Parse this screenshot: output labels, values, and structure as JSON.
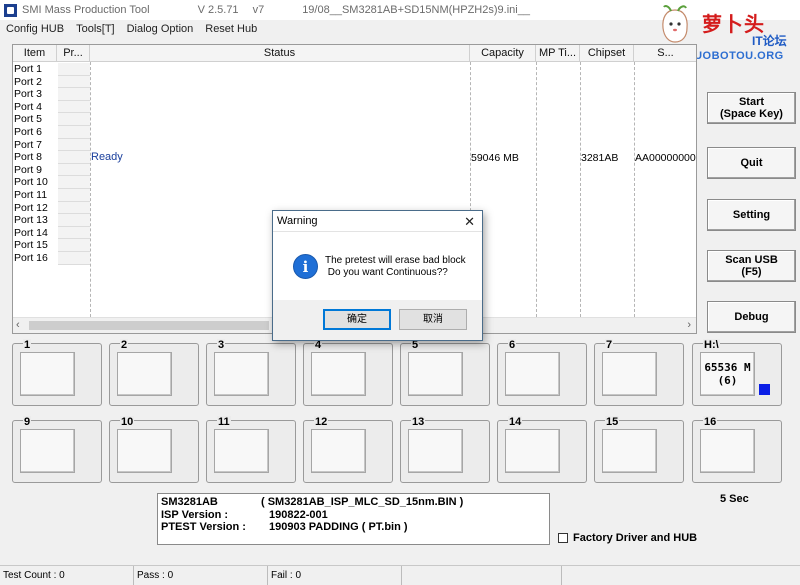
{
  "window": {
    "title": "SMI Mass Production Tool",
    "version": "V 2.5.71",
    "v": "v7",
    "ini": "19/08__SM3281AB+SD15NM(HPZH2s)9.ini__"
  },
  "logo": {
    "main": "萝卜头",
    "sub": "IT论坛",
    "url": "BBS-LUOBOTOU.ORG"
  },
  "menu": [
    "Config HUB",
    "Tools[T]",
    "Dialog Option",
    "Reset Hub"
  ],
  "grid": {
    "headers": [
      "Item",
      "Pr...",
      "Status",
      "Capacity",
      "MP Ti...",
      "Chipset",
      "S..."
    ],
    "ports": [
      "Port 1",
      "Port 2",
      "Port 3",
      "Port 4",
      "Port 5",
      "Port 6",
      "Port 7",
      "Port 8",
      "Port 9",
      "Port 10",
      "Port 11",
      "Port 12",
      "Port 13",
      "Port 14",
      "Port 15",
      "Port 16"
    ],
    "row8": {
      "status": "Ready",
      "capacity": "59046 MB",
      "chipset": "3281AB",
      "serial": "AA00000000"
    }
  },
  "buttons": {
    "start": "Start\n(Space Key)",
    "quit": "Quit",
    "setting": "Setting",
    "scan": "Scan USB\n(F5)",
    "debug": "Debug"
  },
  "port_boxes": [
    "1",
    "2",
    "3",
    "4",
    "5",
    "6",
    "7",
    "9",
    "10",
    "11",
    "12",
    "13",
    "14",
    "15",
    "16"
  ],
  "hub_box": {
    "label": "H:\\",
    "size": "65536 M",
    "count": "(6)",
    "indicator_color": "#0a1ee6"
  },
  "info": {
    "chip": "SM3281AB",
    "chip_bin": "( SM3281AB_ISP_MLC_SD_15nm.BIN )",
    "isp_label": "ISP Version :",
    "isp_value": "190822-001",
    "ptest_label": "PTEST Version :",
    "ptest_value": "190903 PADDING  ( PT.bin )"
  },
  "timer": "5 Sec",
  "checkbox": {
    "label": "Factory Driver and HUB"
  },
  "statusbar": {
    "test_count": "Test Count : 0",
    "pass": "Pass : 0",
    "fail": "Fail : 0"
  },
  "dialog": {
    "title": "Warning",
    "message": "The pretest will erase bad block\n Do you want Continuous??",
    "ok": "确定",
    "cancel": "取消"
  }
}
